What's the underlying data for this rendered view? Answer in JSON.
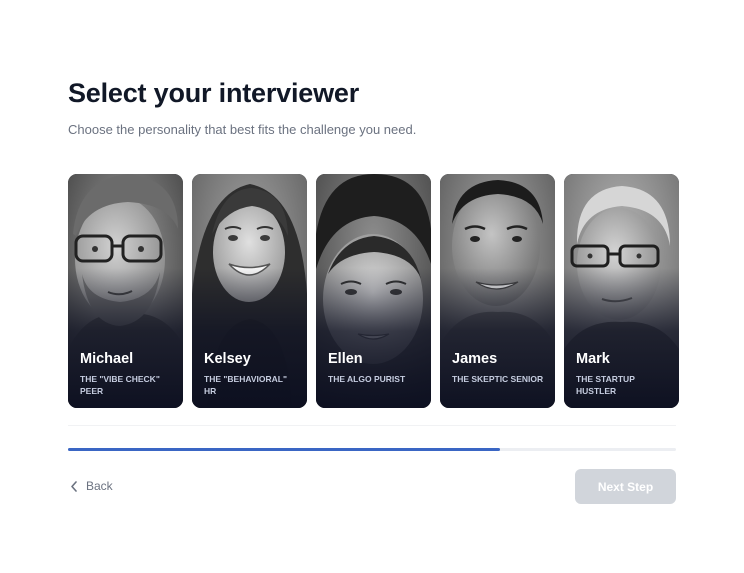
{
  "header": {
    "title": "Select your interviewer",
    "subtitle": "Choose the personality that best fits the challenge you need."
  },
  "interviewers": [
    {
      "name": "Michael",
      "role": "THE \"VIBE CHECK\" PEER"
    },
    {
      "name": "Kelsey",
      "role": "THE \"BEHAVIORAL\" HR"
    },
    {
      "name": "Ellen",
      "role": "THE ALGO PURIST"
    },
    {
      "name": "James",
      "role": "THE SKEPTIC SENIOR"
    },
    {
      "name": "Mark",
      "role": "THE STARTUP HUSTLER"
    }
  ],
  "progress": {
    "fraction": 0.71
  },
  "footer": {
    "back_label": "Back",
    "next_label": "Next Step"
  },
  "colors": {
    "accent": "#3a66c4",
    "disabled_button": "#d1d5db",
    "title": "#111827",
    "muted": "#6b7280"
  },
  "icons": {
    "back": "chevron-left-icon"
  }
}
